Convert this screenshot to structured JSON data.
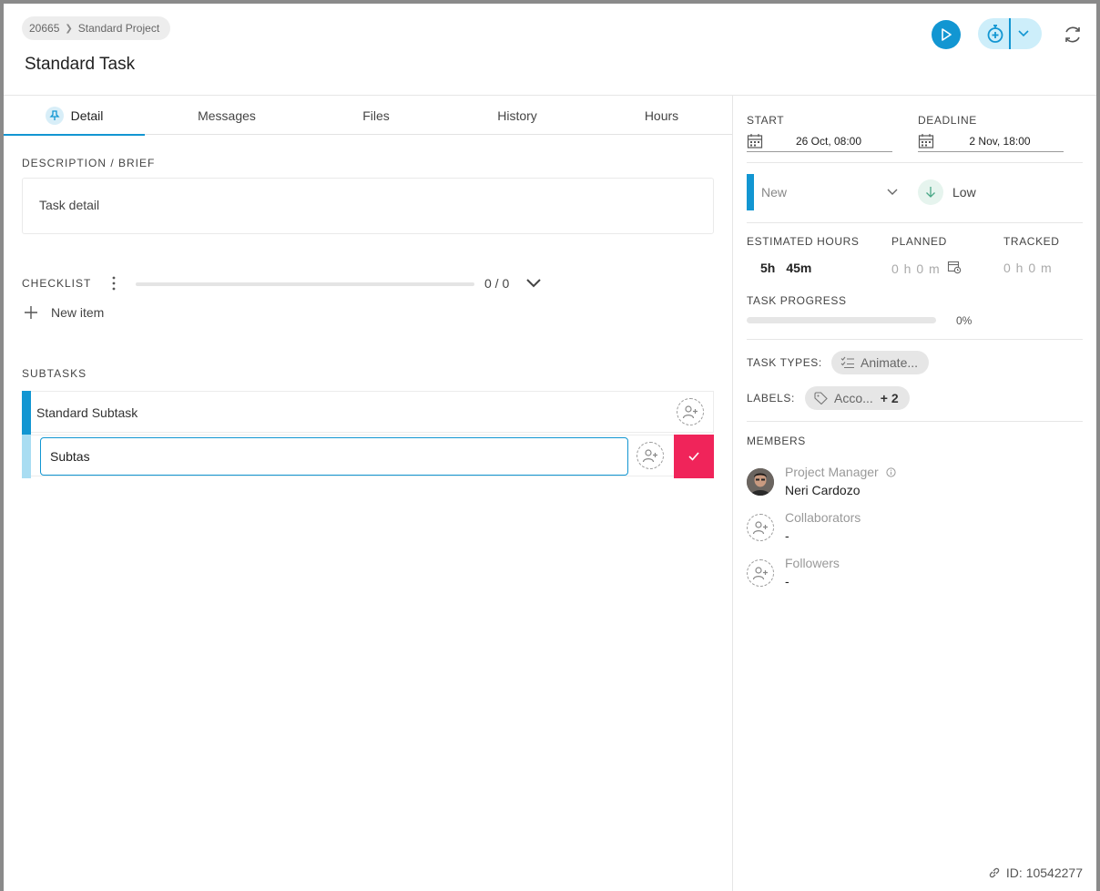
{
  "breadcrumb": {
    "project_id": "20665",
    "project_name": "Standard Project"
  },
  "title": "Standard Task",
  "tabs": [
    {
      "label": "Detail"
    },
    {
      "label": "Messages"
    },
    {
      "label": "Files"
    },
    {
      "label": "History"
    },
    {
      "label": "Hours"
    }
  ],
  "description": {
    "label": "DESCRIPTION / BRIEF",
    "text": "Task detail"
  },
  "checklist": {
    "label": "CHECKLIST",
    "count": "0 / 0",
    "new_item": "New item"
  },
  "subtasks": {
    "label": "SUBTASKS",
    "items": [
      {
        "name": "Standard Subtask"
      }
    ],
    "new_input_value": "Subtas"
  },
  "dates": {
    "start_label": "START",
    "start_value": "26 Oct, 08:00",
    "deadline_label": "DEADLINE",
    "deadline_value": "2 Nov, 18:00"
  },
  "status": {
    "value": "New",
    "color": "#1296d2"
  },
  "priority": {
    "value": "Low"
  },
  "hours": {
    "estimated_label": "ESTIMATED HOURS",
    "estimated_h": "5h",
    "estimated_m": "45m",
    "planned_label": "PLANNED",
    "planned_value": "0 h 0 m",
    "tracked_label": "TRACKED",
    "tracked_value": "0 h 0 m"
  },
  "progress": {
    "label": "TASK PROGRESS",
    "percent": "0%",
    "fraction": 0
  },
  "task_types": {
    "label": "TASK TYPES:",
    "value": "Animate..."
  },
  "labels": {
    "label": "LABELS:",
    "value": "Acco...",
    "more": "+ 2"
  },
  "members": {
    "label": "MEMBERS",
    "project_manager_label": "Project Manager",
    "project_manager_name": "Neri Cardozo",
    "collaborators_label": "Collaborators",
    "collaborators_value": "-",
    "followers_label": "Followers",
    "followers_value": "-"
  },
  "footer": {
    "id_text": "ID: 10542277"
  },
  "colors": {
    "accent": "#1296d2",
    "confirm": "#f0245a",
    "timer_bg": "#cdeefa"
  }
}
